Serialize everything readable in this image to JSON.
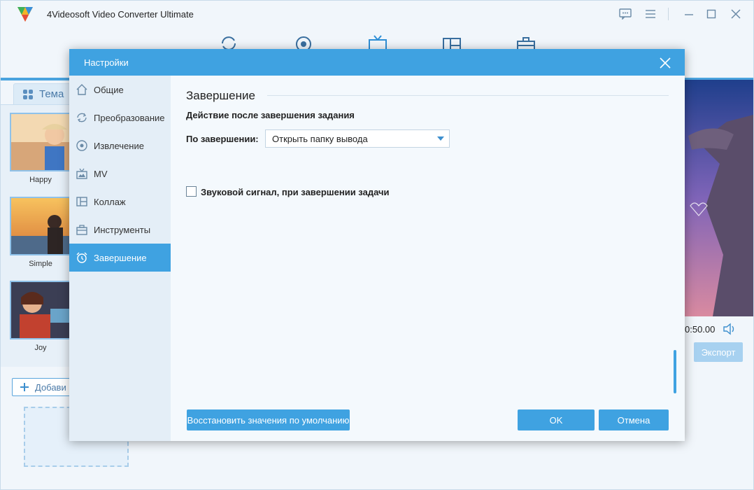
{
  "app": {
    "title": "4Videosoft Video Converter Ultimate"
  },
  "main": {
    "theme_tab_label": "Тема",
    "themes": [
      {
        "label": "Happy"
      },
      {
        "label": "Simple"
      },
      {
        "label": "Joy"
      }
    ],
    "add_button_label": "Добави",
    "time_display": "0:50.00",
    "export_button_label": "Экспорт"
  },
  "dialog": {
    "title": "Настройки",
    "nav": [
      {
        "label": "Общие",
        "icon": "home-icon"
      },
      {
        "label": "Преобразование",
        "icon": "convert-icon"
      },
      {
        "label": "Извлечение",
        "icon": "disc-icon"
      },
      {
        "label": "MV",
        "icon": "tv-icon"
      },
      {
        "label": "Коллаж",
        "icon": "collage-icon"
      },
      {
        "label": "Инструменты",
        "icon": "toolbox-icon"
      },
      {
        "label": "Завершение",
        "icon": "alarm-clock-icon",
        "active": true
      }
    ],
    "section_title": "Завершение",
    "subheading": "Действие после завершения задания",
    "on_finish_label": "По завершении:",
    "on_finish_value": "Открыть папку вывода",
    "sound_label": "Звуковой сигнал, при завершении задачи",
    "sound_checked": false,
    "restore_label": "Восстановить значения по умолчанию",
    "ok_label": "OK",
    "cancel_label": "Отмена"
  },
  "colors": {
    "accent": "#3fa2e1",
    "nav_bg": "#e4eef7",
    "content_bg": "#f4f9fd"
  }
}
